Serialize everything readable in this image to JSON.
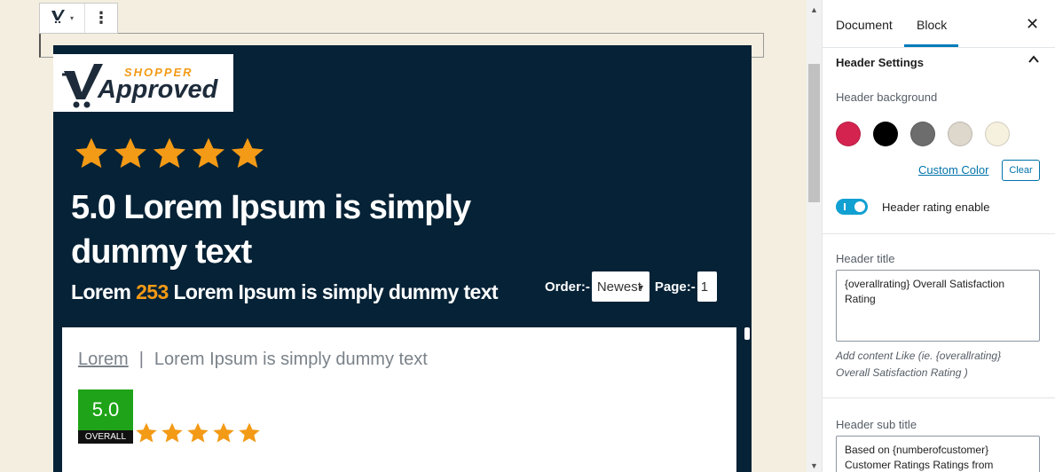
{
  "canvas": {
    "toolbar": {
      "block_caret": "▾",
      "more_label": "⋮"
    },
    "widget": {
      "logo": {
        "brand_top": "SHOPPER",
        "brand_main": "Approved"
      },
      "rating_stars": 5,
      "title": "5.0 Lorem Ipsum is simply dummy text",
      "subtitle_prefix": "Lorem ",
      "subtitle_count": "253",
      "subtitle_suffix": " Lorem Ipsum is simply dummy text",
      "order_label": "Order:-",
      "order_value": "Newest",
      "page_label": "Page:-",
      "page_value": "1",
      "review": {
        "link_text": "Lorem",
        "separator": "|",
        "text": "Lorem Ipsum is simply dummy text",
        "score": "5.0",
        "score_label": "OVERALL",
        "stars": 5
      }
    },
    "scrollbar": {
      "up_arrow": "▲",
      "down_arrow": "▼"
    }
  },
  "sidebar": {
    "tabs": [
      {
        "label": "Document",
        "active": false
      },
      {
        "label": "Block",
        "active": true
      }
    ],
    "close_icon": "✕",
    "panel_title": "Header Settings",
    "header_background_label": "Header background",
    "swatches": [
      {
        "name": "crimson",
        "color": "#d5234f"
      },
      {
        "name": "black",
        "color": "#000000"
      },
      {
        "name": "gray",
        "color": "#6d6d6d"
      },
      {
        "name": "light-beige",
        "color": "#ddd7cc"
      },
      {
        "name": "cream",
        "color": "#f6f0df"
      }
    ],
    "custom_color_label": "Custom Color",
    "clear_label": "Clear",
    "rating_toggle_label": "Header rating enable",
    "rating_toggle_on": true,
    "header_title_label": "Header title",
    "header_title_value": "{overallrating} Overall Satisfaction Rating",
    "header_title_help": "Add content Like (ie. {overallrating} Overall Satisfaction Rating )",
    "header_subtitle_label": "Header sub title",
    "header_subtitle_value": "Based on {numberofcustomer} Customer Ratings Ratings from"
  },
  "colors": {
    "widget_bg": "#052236",
    "star": "#f39a16",
    "score_green": "#1fa318",
    "accent": "#007cba",
    "toggle": "#11a0d2"
  }
}
